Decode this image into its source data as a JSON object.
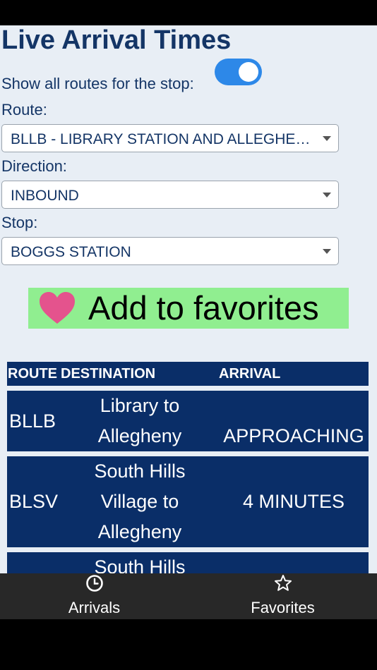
{
  "page": {
    "title": "Live Arrival Times",
    "show_all_label": "Show all routes for the stop:",
    "show_all_enabled": true
  },
  "filters": {
    "route_label": "Route:",
    "route_value": "BLLB - LIBRARY STATION AND ALLEGHENY",
    "direction_label": "Direction:",
    "direction_value": "INBOUND",
    "stop_label": "Stop:",
    "stop_value": "BOGGS STATION"
  },
  "favorite_button": {
    "label": "Add to favorites",
    "icon": "heart-icon"
  },
  "table": {
    "headers": {
      "route": "ROUTE",
      "destination": "DESTINATION",
      "arrival": "ARRIVAL"
    },
    "rows": [
      {
        "route": "BLLB",
        "dest_lines": [
          "Library to",
          "Allegheny"
        ],
        "arrival": "APPROACHING"
      },
      {
        "route": "BLSV",
        "dest_lines": [
          "South Hills",
          "Village to",
          "Allegheny"
        ],
        "arrival": "4 MINUTES"
      },
      {
        "route": "",
        "dest_lines": [
          "South Hills"
        ],
        "arrival": ""
      }
    ]
  },
  "nav": {
    "items": [
      {
        "label": "Arrivals",
        "icon": "clock-icon"
      },
      {
        "label": "Favorites",
        "icon": "star-icon"
      }
    ]
  },
  "colors": {
    "page_bg": "#e8eef5",
    "title": "#143566",
    "table_bg": "#0a2e68",
    "toggle_on": "#2d88e8",
    "favorite_bg": "#90ee90",
    "heart": "#e4538d",
    "nav_bg": "#282828"
  }
}
